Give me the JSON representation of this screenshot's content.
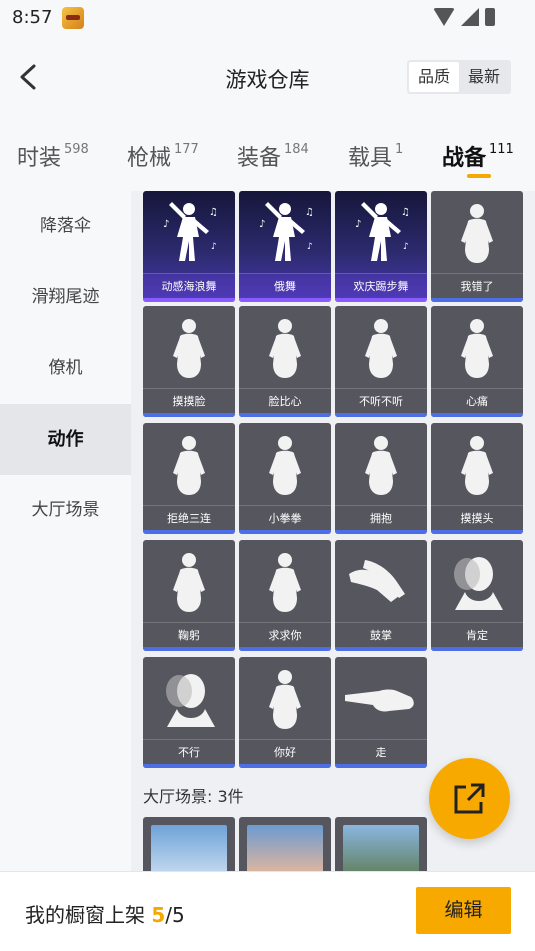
{
  "status_bar": {
    "time": "8:57"
  },
  "header": {
    "title": "游戏仓库",
    "sort_options": [
      "品质",
      "最新"
    ],
    "active_sort": "品质"
  },
  "tabs": [
    {
      "label": "时装",
      "count": "598"
    },
    {
      "label": "枪械",
      "count": "177"
    },
    {
      "label": "装备",
      "count": "184"
    },
    {
      "label": "载具",
      "count": "1"
    },
    {
      "label": "战备",
      "count": "111"
    }
  ],
  "active_tab": "战备",
  "sidebar": {
    "items": [
      "降落伞",
      "滑翔尾迹",
      "僚机",
      "动作",
      "大厅场景"
    ],
    "active": "动作"
  },
  "actions": [
    {
      "label": "动感海浪舞",
      "style": "purple",
      "icon": "dance-figure-icon"
    },
    {
      "label": "俄舞",
      "style": "purple",
      "icon": "dance-figure-icon"
    },
    {
      "label": "欢庆踢步舞",
      "style": "purple",
      "icon": "dance-figure-icon"
    },
    {
      "label": "我错了",
      "style": "grey",
      "icon": "figure-icon"
    },
    {
      "label": "摸摸脸",
      "style": "grey",
      "icon": "figure-icon"
    },
    {
      "label": "脸比心",
      "style": "grey",
      "icon": "figure-icon"
    },
    {
      "label": "不听不听",
      "style": "grey",
      "icon": "figure-icon"
    },
    {
      "label": "心痛",
      "style": "grey",
      "icon": "figure-icon"
    },
    {
      "label": "拒绝三连",
      "style": "grey",
      "icon": "figure-icon"
    },
    {
      "label": "小拳拳",
      "style": "grey",
      "icon": "figure-icon"
    },
    {
      "label": "拥抱",
      "style": "grey",
      "icon": "figure-icon"
    },
    {
      "label": "摸摸头",
      "style": "grey",
      "icon": "figure-icon"
    },
    {
      "label": "鞠躬",
      "style": "grey",
      "icon": "figure-icon"
    },
    {
      "label": "求求你",
      "style": "grey",
      "icon": "figure-icon"
    },
    {
      "label": "鼓掌",
      "style": "grey",
      "icon": "hands-icon"
    },
    {
      "label": "肯定",
      "style": "grey",
      "icon": "head-icon"
    },
    {
      "label": "不行",
      "style": "grey",
      "icon": "head-icon"
    },
    {
      "label": "你好",
      "style": "grey",
      "icon": "figure-icon"
    },
    {
      "label": "走",
      "style": "grey",
      "icon": "pointing-hand-icon"
    }
  ],
  "lobby_section": {
    "title": "大厅场景: 3件"
  },
  "bottom_bar": {
    "label": "我的橱窗上架",
    "current": "5",
    "separator": "/",
    "total": "5",
    "edit_label": "编辑"
  },
  "colors": {
    "accent": "#f7a900",
    "card": "#56565f",
    "rare_card": "#2c2a6e",
    "bar": "#4e6ee6"
  }
}
